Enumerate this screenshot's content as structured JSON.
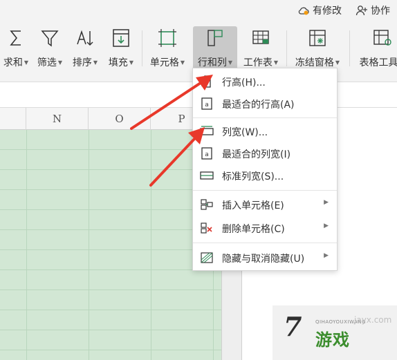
{
  "topbar": {
    "revise_label": "有修改",
    "collab_label": "协作"
  },
  "ribbon": {
    "sum_label": "求和",
    "filter_label": "筛选",
    "sort_label": "排序",
    "fill_label": "填充",
    "cell_label": "单元格",
    "rowcol_label": "行和列",
    "worksheet_label": "工作表",
    "freeze_label": "冻结窗格",
    "tabletools_label": "表格工具"
  },
  "sheet": {
    "columns": [
      "N",
      "O",
      "P"
    ]
  },
  "menu": {
    "items": [
      {
        "label": "行高(H)..."
      },
      {
        "label": "最适合的行高(A)"
      },
      {
        "label": "列宽(W)..."
      },
      {
        "label": "最适合的列宽(I)"
      },
      {
        "label": "标准列宽(S)..."
      },
      {
        "label": "插入单元格(E)"
      },
      {
        "label": "删除单元格(C)"
      },
      {
        "label": "隐藏与取消隐藏(U)"
      }
    ]
  },
  "watermark": {
    "big": "7",
    "text": "游戏",
    "small": "QIHAOYOUXIWANG",
    "url": "jayx.com"
  },
  "colors": {
    "grid_fill": "#d2e7d4",
    "arrow_red": "#e8382a",
    "active_button": "#c9c9c9"
  }
}
